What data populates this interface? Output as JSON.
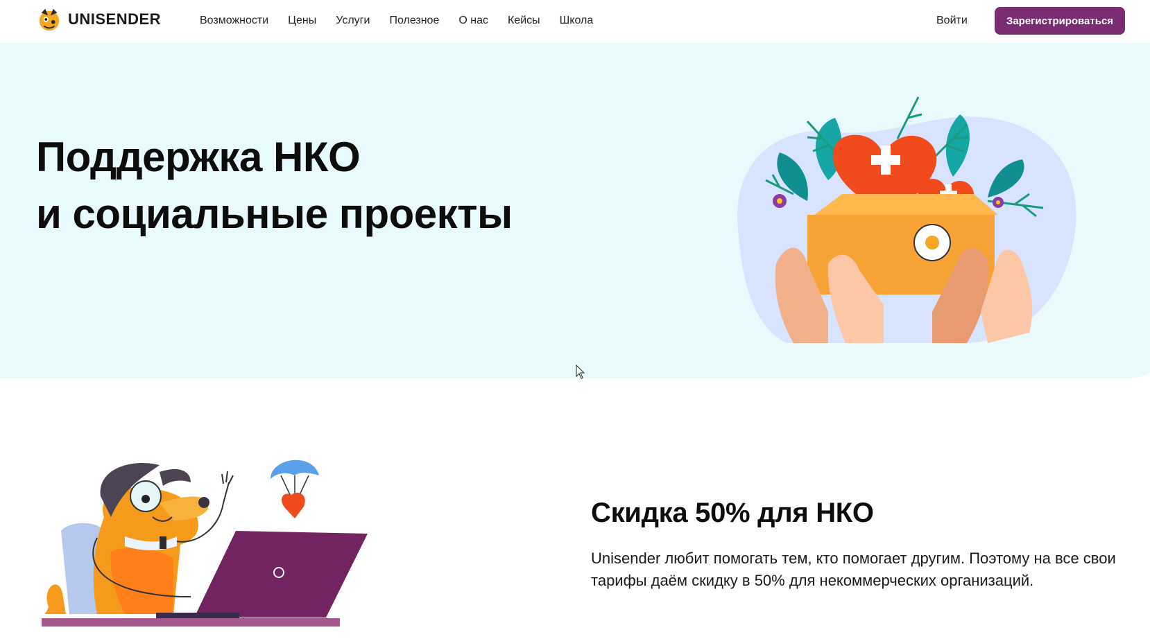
{
  "header": {
    "logo_text": "UNISENDER",
    "nav": [
      "Возможности",
      "Цены",
      "Услуги",
      "Полезное",
      "О нас",
      "Кейсы",
      "Школа"
    ],
    "login_label": "Войти",
    "signup_label": "Зарегистрироваться"
  },
  "hero": {
    "title_line1": "Поддержка НКО",
    "title_line2": "и социальные проекты",
    "illustration_icon": "hands-holding-box-with-hearts-illustration"
  },
  "discount": {
    "title": "Скидка 50% для НКО",
    "text": "Unisender любит помогать тем, кто помогает другим. Поэтому на все свои тарифы даём скидку в 50% для некоммерческих организаций.",
    "illustration_icon": "dog-with-laptop-illustration"
  },
  "colors": {
    "brand": "#7b2d74",
    "hero_bg": "#e8fafd",
    "accent_orange": "#f59a1b",
    "heart_red": "#f04a1d"
  }
}
